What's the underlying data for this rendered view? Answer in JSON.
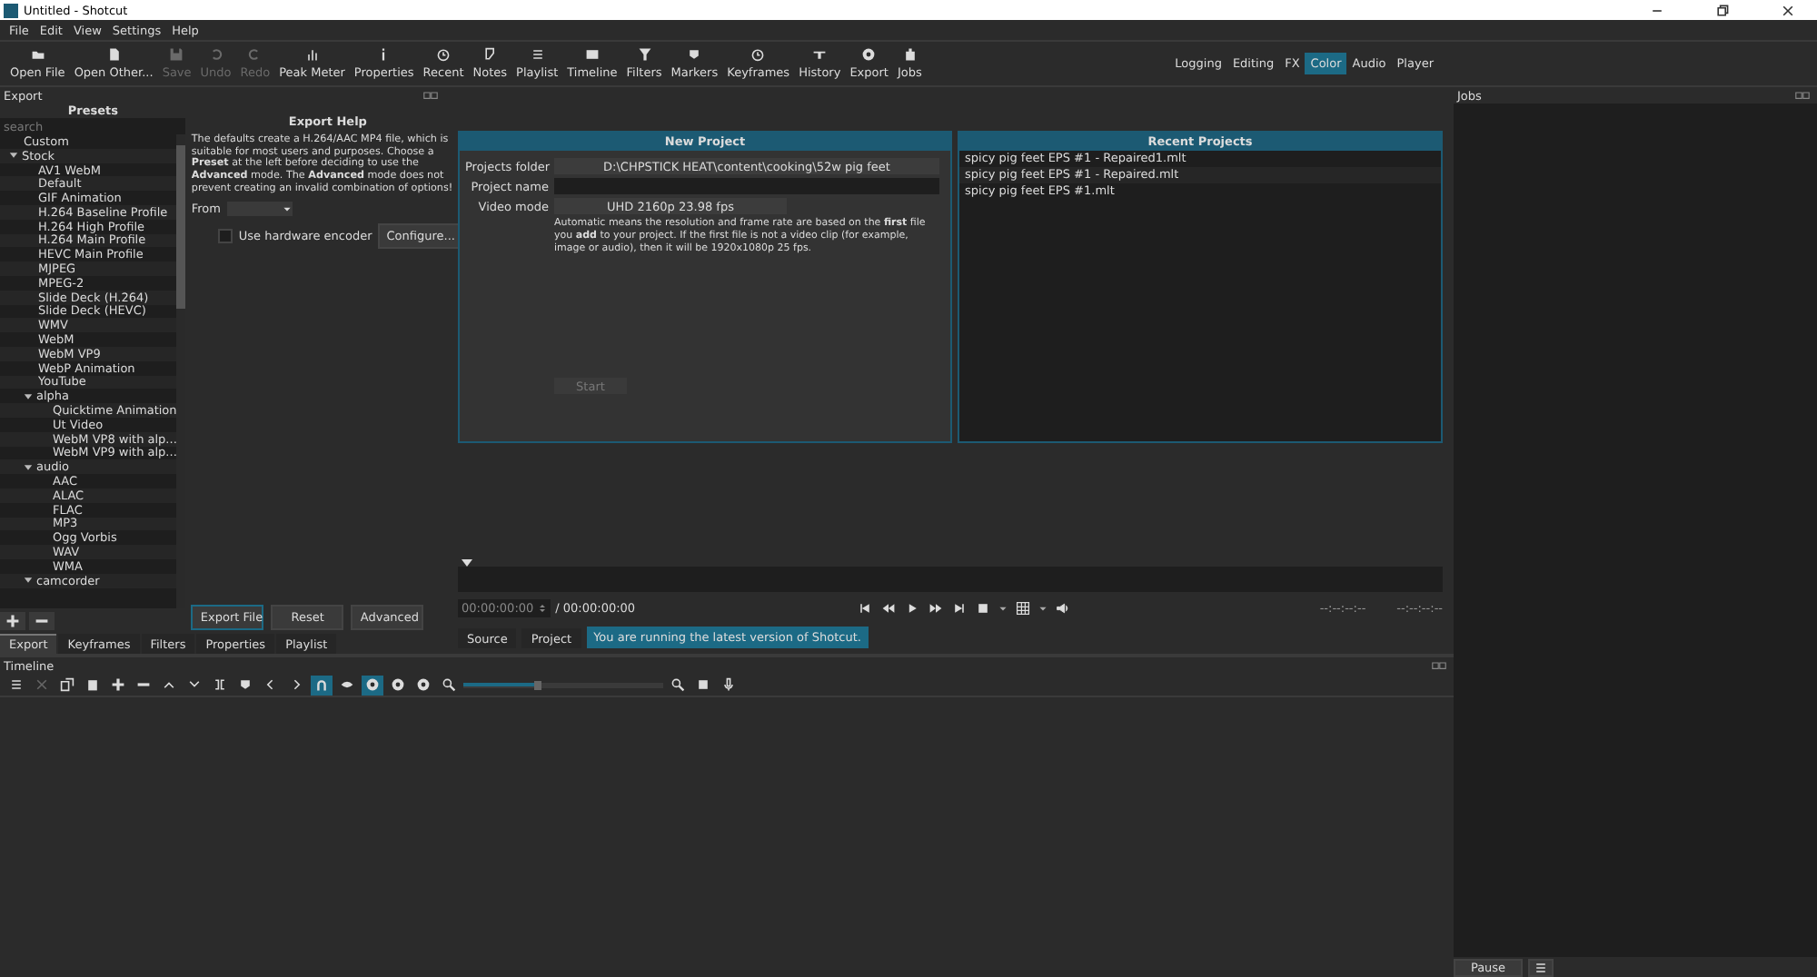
{
  "window": {
    "title": "Untitled - Shotcut"
  },
  "menu": [
    "File",
    "Edit",
    "View",
    "Settings",
    "Help"
  ],
  "toolbar": [
    {
      "label": "Open File",
      "disabled": false
    },
    {
      "label": "Open Other...",
      "disabled": false
    },
    {
      "label": "Save",
      "disabled": true
    },
    {
      "label": "Undo",
      "disabled": true
    },
    {
      "label": "Redo",
      "disabled": true
    },
    {
      "label": "Peak Meter",
      "disabled": false
    },
    {
      "label": "Properties",
      "disabled": false
    },
    {
      "label": "Recent",
      "disabled": false
    },
    {
      "label": "Notes",
      "disabled": false
    },
    {
      "label": "Playlist",
      "disabled": false
    },
    {
      "label": "Timeline",
      "disabled": false
    },
    {
      "label": "Filters",
      "disabled": false
    },
    {
      "label": "Markers",
      "disabled": false
    },
    {
      "label": "Keyframes",
      "disabled": false
    },
    {
      "label": "History",
      "disabled": false
    },
    {
      "label": "Export",
      "disabled": false
    },
    {
      "label": "Jobs",
      "disabled": false
    }
  ],
  "layouts": [
    {
      "label": "Logging",
      "selected": false
    },
    {
      "label": "Editing",
      "selected": false
    },
    {
      "label": "FX",
      "selected": false
    },
    {
      "label": "Color",
      "selected": true
    },
    {
      "label": "Audio",
      "selected": false
    },
    {
      "label": "Player",
      "selected": false
    }
  ],
  "export_panel": {
    "title": "Export",
    "presets_title": "Presets",
    "search": {
      "placeholder": "search"
    },
    "presets": [
      {
        "label": "Custom"
      },
      {
        "label": "Stock",
        "expanded": true,
        "children": [
          {
            "label": "AV1 WebM"
          },
          {
            "label": "Default"
          },
          {
            "label": "GIF Animation"
          },
          {
            "label": "H.264 Baseline Profile"
          },
          {
            "label": "H.264 High Profile"
          },
          {
            "label": "H.264 Main Profile"
          },
          {
            "label": "HEVC Main Profile"
          },
          {
            "label": "MJPEG"
          },
          {
            "label": "MPEG-2"
          },
          {
            "label": "Slide Deck (H.264)"
          },
          {
            "label": "Slide Deck (HEVC)"
          },
          {
            "label": "WMV"
          },
          {
            "label": "WebM"
          },
          {
            "label": "WebM VP9"
          },
          {
            "label": "WebP Animation"
          },
          {
            "label": "YouTube"
          },
          {
            "label": "alpha",
            "expanded": true,
            "children": [
              {
                "label": "Quicktime Animation"
              },
              {
                "label": "Ut Video"
              },
              {
                "label": "WebM VP8 with alp..."
              },
              {
                "label": "WebM VP9 with alp..."
              }
            ]
          },
          {
            "label": "audio",
            "expanded": true,
            "children": [
              {
                "label": "AAC"
              },
              {
                "label": "ALAC"
              },
              {
                "label": "FLAC"
              },
              {
                "label": "MP3"
              },
              {
                "label": "Ogg Vorbis"
              },
              {
                "label": "WAV"
              },
              {
                "label": "WMA"
              }
            ]
          },
          {
            "label": "camcorder",
            "expanded": true
          }
        ]
      }
    ],
    "help_title": "Export Help",
    "help_text": "The defaults create a H.264/AAC MP4 file, which is suitable for most users and purposes. Choose a **Preset** at the left before deciding to use the **Advanced** mode. The **Advanced** mode does not prevent creating an invalid combination of options!",
    "from_label": "From",
    "hardware_encoder": {
      "label": "Use hardware encoder",
      "checked": false
    },
    "configure_button": "Configure...",
    "buttons": [
      "Export File",
      "Reset",
      "Advanced"
    ]
  },
  "dock_tabs": [
    {
      "label": "Export",
      "selected": true
    },
    {
      "label": "Keyframes",
      "selected": false
    },
    {
      "label": "Filters",
      "selected": false
    },
    {
      "label": "Properties",
      "selected": false
    },
    {
      "label": "Playlist",
      "selected": false
    }
  ],
  "new_project": {
    "title": "New Project",
    "folder_label": "Projects folder",
    "folder": "D:\\CHPSTICK HEAT\\content\\cooking\\52w pig feet",
    "name_label": "Project name",
    "mode_label": "Video mode",
    "mode": "UHD 2160p 23.98 fps",
    "note": "Automatic means the resolution and frame rate are based on the **first** file you **add** to your project. If the first file is not a video clip (for example, image or audio), then it will be 1920x1080p 25 fps.",
    "start_button": "Start"
  },
  "recent_projects": {
    "title": "Recent Projects",
    "items": [
      "spicy pig feet  EPS #1 - Repaired1.mlt",
      "spicy pig feet  EPS #1 - Repaired.mlt",
      "spicy pig feet  EPS #1.mlt"
    ]
  },
  "player": {
    "timecode": "00:00:00:00",
    "duration": "/ 00:00:00:00",
    "in_point": "--:--:--:--",
    "out_point": "--:--:--:--",
    "tabs": [
      {
        "label": "Source",
        "selected": false
      },
      {
        "label": "Project",
        "selected": false
      }
    ],
    "notice": "You are running the latest version of Shotcut."
  },
  "timeline": {
    "title": "Timeline",
    "tools": [
      {
        "selected": false,
        "disabled": false
      },
      {
        "selected": false,
        "disabled": true
      },
      {
        "selected": false,
        "disabled": false
      },
      {
        "selected": false,
        "disabled": false
      },
      {
        "selected": false,
        "disabled": false
      },
      {
        "selected": false,
        "disabled": false
      },
      {
        "selected": false,
        "disabled": false
      },
      {
        "selected": false,
        "disabled": false
      },
      {
        "selected": false,
        "disabled": false
      },
      {
        "selected": false,
        "disabled": false
      },
      {
        "selected": false,
        "disabled": false
      },
      {
        "selected": false,
        "disabled": false
      },
      {
        "selected": true,
        "disabled": false
      },
      {
        "selected": false,
        "disabled": false
      },
      {
        "selected": true,
        "disabled": false
      },
      {
        "selected": false,
        "disabled": false
      },
      {
        "selected": false,
        "disabled": false
      }
    ],
    "zoom": {
      "level": 0.35
    }
  },
  "jobs": {
    "title": "Jobs",
    "pause_button": "Pause"
  }
}
